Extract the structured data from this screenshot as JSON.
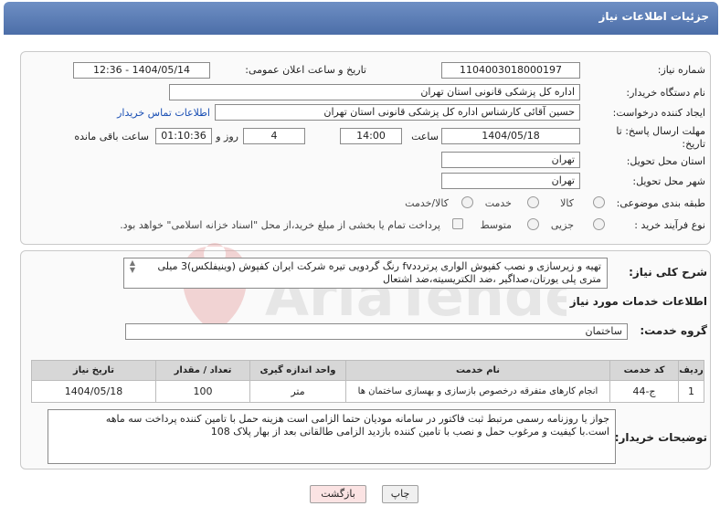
{
  "header": {
    "title": "جزئیات اطلاعات نیاز"
  },
  "form": {
    "need_number": {
      "label": "شماره نیاز:",
      "value": "1104003018000197"
    },
    "announce_datetime": {
      "label": "تاریخ و ساعت اعلان عمومی:",
      "value": "1404/05/14 - 12:36"
    },
    "buyer_org": {
      "label": "نام دستگاه خریدار:",
      "value": "اداره کل پزشکی قانونی استان تهران"
    },
    "requester": {
      "label": "ایجاد کننده درخواست:",
      "value": "حسین آقائی کارشناس اداره کل پزشکی قانونی استان تهران",
      "contact_link": "اطلاعات تماس خریدار"
    },
    "deadline": {
      "label_line1": "مهلت ارسال پاسخ: تا",
      "label_line2": "تاریخ:",
      "date": "1404/05/18",
      "time_label": "ساعت",
      "time": "14:00",
      "days": "4",
      "days_label": "روز و",
      "remaining": "01:10:36",
      "remaining_label": "ساعت باقی مانده"
    },
    "delivery_province": {
      "label": "استان محل تحویل:",
      "value": "تهران"
    },
    "delivery_city": {
      "label": "شهر محل تحویل:",
      "value": "تهران"
    },
    "category": {
      "label": "طبقه بندی موضوعی:",
      "options": [
        "کالا",
        "خدمت",
        "کالا/خدمت"
      ]
    },
    "purchase_type": {
      "label": "نوع فرآیند خرید :",
      "options": [
        "جزیی",
        "متوسط"
      ],
      "payment_note": "پرداخت تمام یا بخشی از مبلغ خرید،از محل \"اسناد خزانه اسلامی\" خواهد بود."
    }
  },
  "general_description": {
    "label": "شرح کلی نیاز:",
    "text_line1": "تهیه و زیرسازی و نصب کفپوش الواری پرترددfv رنگ گردویی تیره شرکت ایران کفپوش (وینیفلکس)3 میلی",
    "text_line2": "متری پلی یورتان،صداگیر ،ضد الکتریسیته،ضد اشتعال"
  },
  "services_section": {
    "title": "اطلاعات خدمات مورد نیاز",
    "group_label": "گروه خدمت:",
    "group_value": "ساختمان"
  },
  "table": {
    "headers": [
      "ردیف",
      "کد خدمت",
      "نام خدمت",
      "واحد اندازه گیری",
      "تعداد / مقدار",
      "تاریخ نیاز"
    ],
    "rows": [
      [
        "1",
        "ج-44",
        "انجام کارهای متفرقه درخصوص بازسازی و بهسازی ساختمان ها",
        "متر",
        "100",
        "1404/05/18"
      ]
    ]
  },
  "buyer_notes": {
    "label": "توضیحات خریدار:",
    "line1": "جواز یا روزنامه رسمی مرتبط ثبت فاکتور در سامانه مودیان حتما الزامی است هزینه حمل با تامین کننده پرداخت سه ماهه",
    "line2": "است.با کیفیت و مرغوب حمل و نصب با تامین کننده بازدید الزامی طالقانی بعد از بهار پلاک 108"
  },
  "buttons": {
    "print": "چاپ",
    "back": "بازگشت"
  },
  "watermark": {
    "text": "AriaTender.neT"
  }
}
